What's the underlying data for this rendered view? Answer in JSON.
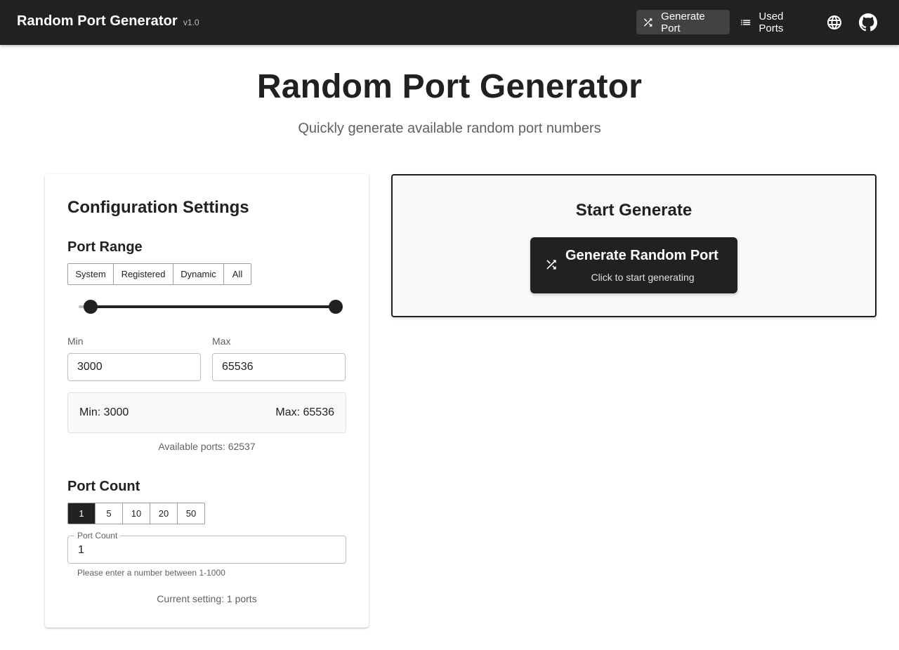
{
  "appbar": {
    "title": "Random Port Generator",
    "version": "v1.0",
    "nav": [
      {
        "label": "Generate Port",
        "icon": "shuffle-icon",
        "active": true
      },
      {
        "label": "Used Ports",
        "icon": "list-icon",
        "active": false
      }
    ],
    "icons": [
      "globe-icon",
      "github-icon"
    ]
  },
  "hero": {
    "title": "Random Port Generator",
    "subtitle": "Quickly generate available random port numbers"
  },
  "config": {
    "title": "Configuration Settings",
    "port_range": {
      "title": "Port Range",
      "presets": [
        "System",
        "Registered",
        "Dynamic",
        "All"
      ],
      "slider": {
        "min": 0,
        "max": 65535,
        "low": 3000,
        "high": 65535
      },
      "min_label": "Min",
      "max_label": "Max",
      "min_value": "3000",
      "max_value": "65536",
      "summary_min": "Min: 3000",
      "summary_max": "Max: 65536",
      "available": "Available ports: 62537"
    },
    "port_count": {
      "title": "Port Count",
      "presets": [
        "1",
        "5",
        "10",
        "20",
        "50"
      ],
      "selected": "1",
      "field_label": "Port Count",
      "field_value": "1",
      "helper": "Please enter a number between 1-1000",
      "current": "Current setting: 1 ports"
    }
  },
  "generate": {
    "title": "Start Generate",
    "button_label": "Generate Random Port",
    "button_hint": "Click to start generating"
  },
  "colors": {
    "appbar": "#212121",
    "accent": "#212121",
    "card_bg": "#f9f9f9"
  }
}
